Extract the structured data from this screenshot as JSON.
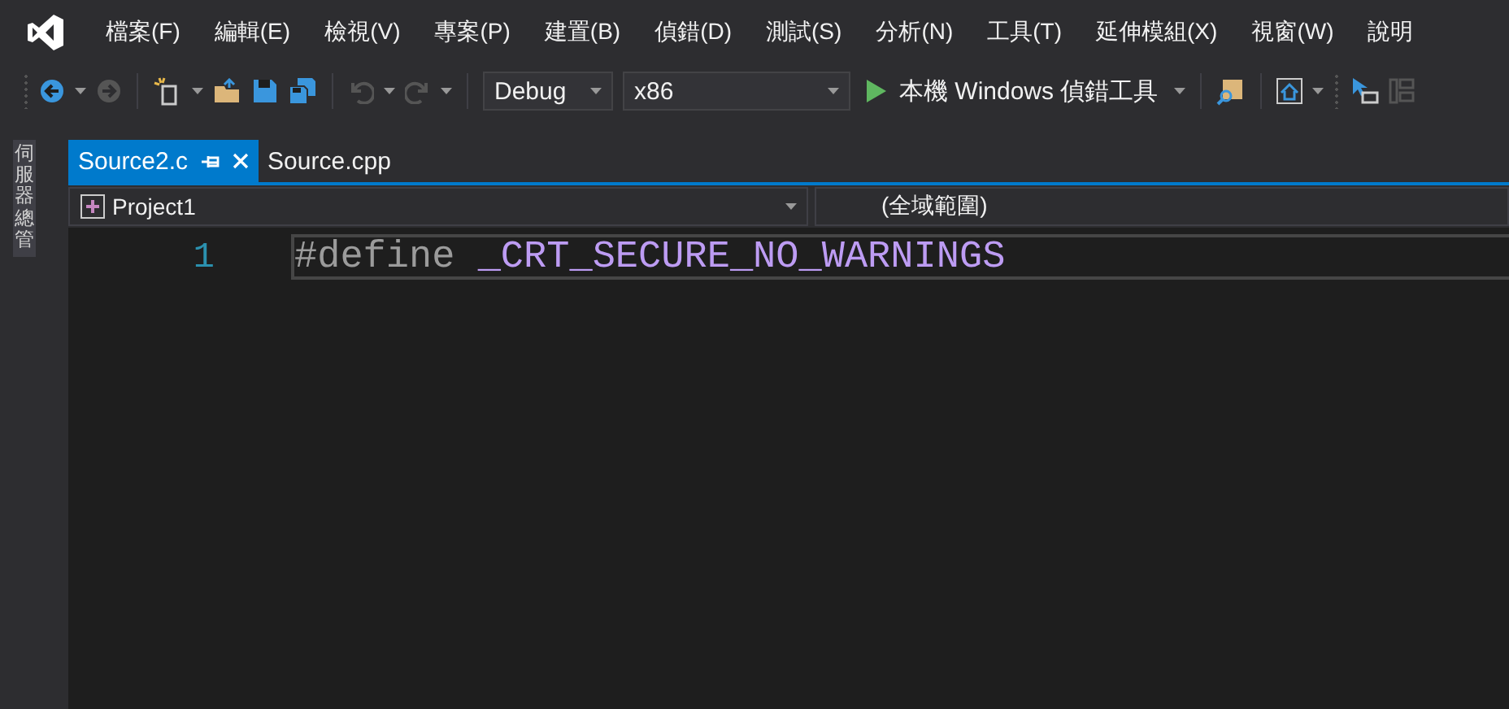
{
  "menu": [
    "檔案(F)",
    "編輯(E)",
    "檢視(V)",
    "專案(P)",
    "建置(B)",
    "偵錯(D)",
    "測試(S)",
    "分析(N)",
    "工具(T)",
    "延伸模組(X)",
    "視窗(W)",
    "說明"
  ],
  "toolbar": {
    "configuration": "Debug",
    "platform": "x86",
    "run_label": "本機 Windows 偵錯工具"
  },
  "side_panel": {
    "label": "伺服器總管"
  },
  "tabs": [
    {
      "label": "Source2.c",
      "selected": true
    },
    {
      "label": "Source.cpp",
      "selected": false
    }
  ],
  "navigation": {
    "project": "Project1",
    "scope": "(全域範圍)"
  },
  "editor": {
    "lines": [
      {
        "number": "1",
        "tokens": [
          {
            "kind": "preprocessor",
            "text": "#define"
          },
          {
            "kind": "macro",
            "text": "_CRT_SECURE_NO_WARNINGS"
          }
        ]
      }
    ]
  }
}
